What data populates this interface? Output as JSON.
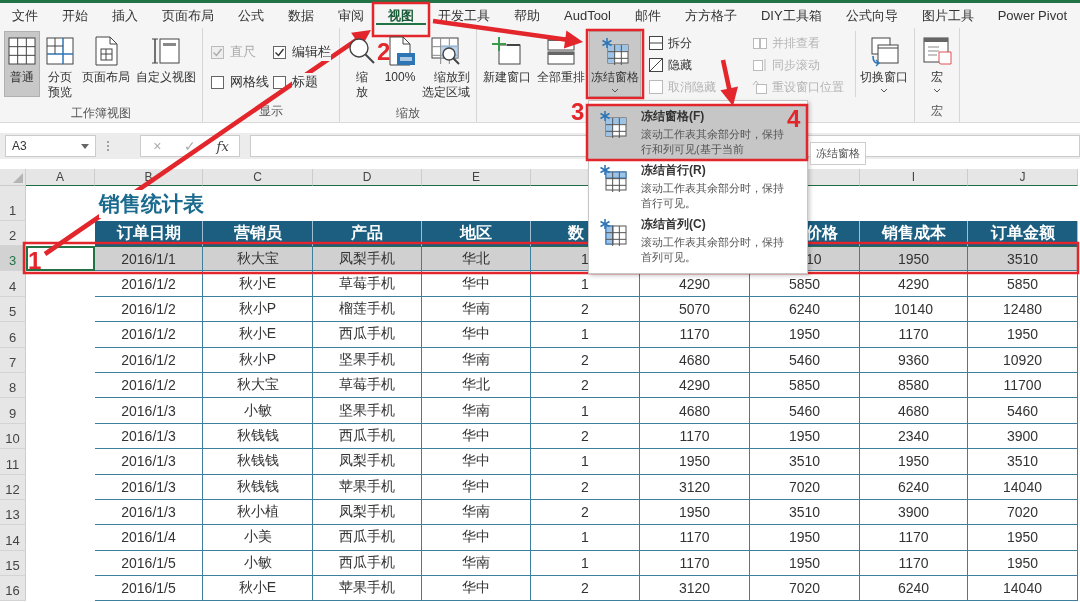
{
  "tabs": [
    {
      "label": "文件",
      "selected": false
    },
    {
      "label": "开始",
      "selected": false
    },
    {
      "label": "插入",
      "selected": false
    },
    {
      "label": "页面布局",
      "selected": false
    },
    {
      "label": "公式",
      "selected": false
    },
    {
      "label": "数据",
      "selected": false
    },
    {
      "label": "审阅",
      "selected": false
    },
    {
      "label": "视图",
      "selected": true
    },
    {
      "label": "开发工具",
      "selected": false
    },
    {
      "label": "帮助",
      "selected": false
    },
    {
      "label": "AudTool",
      "selected": false
    },
    {
      "label": "邮件",
      "selected": false
    },
    {
      "label": "方方格子",
      "selected": false
    },
    {
      "label": "DIY工具箱",
      "selected": false
    },
    {
      "label": "公式向导",
      "selected": false
    },
    {
      "label": "图片工具",
      "selected": false
    },
    {
      "label": "Power Pivot",
      "selected": false
    }
  ],
  "ribbon": {
    "groups": [
      {
        "label": "工作簿视图",
        "items": [
          {
            "kind": "large",
            "label": "普通",
            "selected": true,
            "has_menu": false
          },
          {
            "kind": "large_stacked",
            "label": "分页预览",
            "selected": false,
            "has_menu": false
          },
          {
            "kind": "large",
            "label": "页面布局",
            "selected": false,
            "has_menu": false
          },
          {
            "kind": "large",
            "label": "自定义视图",
            "selected": false,
            "has_menu": false
          }
        ]
      },
      {
        "label": "显示",
        "items": [
          {
            "kind": "check_grid",
            "items": [
              {
                "label": "直尺",
                "checked": true,
                "disabled": true
              },
              {
                "label": "编辑栏",
                "checked": true,
                "disabled": false
              },
              {
                "label": "网格线",
                "checked": false,
                "disabled": false
              },
              {
                "label": "标题",
                "checked": false,
                "disabled": false
              }
            ]
          }
        ]
      },
      {
        "label": "缩放",
        "items": [
          {
            "kind": "large_stacked",
            "label": "缩放",
            "selected": false,
            "has_menu": false
          },
          {
            "kind": "large",
            "label": "100%",
            "selected": false,
            "has_menu": false
          },
          {
            "kind": "large_stacked",
            "label": "缩放到选定区域",
            "selected": false,
            "has_menu": false
          }
        ]
      },
      {
        "items": [
          {
            "kind": "large",
            "label": "新建窗口",
            "selected": false,
            "has_menu": false
          },
          {
            "kind": "large",
            "label": "全部重排",
            "selected": false,
            "has_menu": false
          },
          {
            "kind": "large",
            "label": "冻结窗格",
            "selected": true,
            "has_menu": true
          },
          {
            "kind": "stack",
            "items": [
              {
                "label": "拆分",
                "disabled": false
              },
              {
                "label": "隐藏",
                "disabled": false
              },
              {
                "label": "取消隐藏",
                "disabled": true
              }
            ]
          },
          {
            "kind": "stack",
            "items": [
              {
                "label": "并排查看",
                "disabled": true
              },
              {
                "label": "同步滚动",
                "disabled": true
              },
              {
                "label": "重设窗口位置",
                "disabled": true
              }
            ]
          },
          {
            "kind": "large",
            "label": "切换窗口",
            "selected": false,
            "has_menu": true
          }
        ]
      },
      {
        "label": "宏",
        "items": [
          {
            "kind": "large",
            "label": "宏",
            "selected": false,
            "has_menu": true
          }
        ]
      }
    ]
  },
  "formula_bar": {
    "name_box": "A3",
    "buttons": [
      "×",
      "✓",
      "fx"
    ]
  },
  "sheet": {
    "columns": [
      "A",
      "B",
      "C",
      "D",
      "E",
      null,
      null,
      null,
      "I",
      "J"
    ],
    "rows": [
      {
        "number": "1",
        "kind": "title",
        "selected": false,
        "cells": [
          "",
          "销售统计表"
        ]
      },
      {
        "number": "2",
        "kind": "header",
        "selected": false,
        "cells": [
          "",
          "订单日期",
          "营销员",
          "产品",
          "地区",
          "数",
          null,
          "价格",
          "销售成本",
          "订单金额"
        ]
      },
      {
        "number": "3",
        "kind": "data",
        "selected": true,
        "cells": [
          "",
          "2016/1/1",
          "秋大宝",
          "凤梨手机",
          "华北",
          "1",
          null,
          "10",
          "1950",
          "3510"
        ]
      },
      {
        "number": "4",
        "kind": "data",
        "selected": false,
        "cells": [
          "",
          "2016/1/2",
          "秋小E",
          "草莓手机",
          "华中",
          "1",
          "4290",
          "5850",
          "4290",
          "5850"
        ]
      },
      {
        "number": "5",
        "kind": "data",
        "selected": false,
        "cells": [
          "",
          "2016/1/2",
          "秋小P",
          "榴莲手机",
          "华南",
          "2",
          "5070",
          "6240",
          "10140",
          "12480"
        ]
      },
      {
        "number": "6",
        "kind": "data",
        "selected": false,
        "cells": [
          "",
          "2016/1/2",
          "秋小E",
          "西瓜手机",
          "华中",
          "1",
          "1170",
          "1950",
          "1170",
          "1950"
        ]
      },
      {
        "number": "7",
        "kind": "data",
        "selected": false,
        "cells": [
          "",
          "2016/1/2",
          "秋小P",
          "坚果手机",
          "华南",
          "2",
          "4680",
          "5460",
          "9360",
          "10920"
        ]
      },
      {
        "number": "8",
        "kind": "data",
        "selected": false,
        "cells": [
          "",
          "2016/1/2",
          "秋大宝",
          "草莓手机",
          "华北",
          "2",
          "4290",
          "5850",
          "8580",
          "11700"
        ]
      },
      {
        "number": "9",
        "kind": "data",
        "selected": false,
        "cells": [
          "",
          "2016/1/3",
          "小敏",
          "坚果手机",
          "华南",
          "1",
          "4680",
          "5460",
          "4680",
          "5460"
        ]
      },
      {
        "number": "10",
        "kind": "data",
        "selected": false,
        "cells": [
          "",
          "2016/1/3",
          "秋钱钱",
          "西瓜手机",
          "华中",
          "2",
          "1170",
          "1950",
          "2340",
          "3900"
        ]
      },
      {
        "number": "11",
        "kind": "data",
        "selected": false,
        "cells": [
          "",
          "2016/1/3",
          "秋钱钱",
          "凤梨手机",
          "华中",
          "1",
          "1950",
          "3510",
          "1950",
          "3510"
        ]
      },
      {
        "number": "12",
        "kind": "data",
        "selected": false,
        "cells": [
          "",
          "2016/1/3",
          "秋钱钱",
          "苹果手机",
          "华中",
          "2",
          "3120",
          "7020",
          "6240",
          "14040"
        ]
      },
      {
        "number": "13",
        "kind": "data",
        "selected": false,
        "cells": [
          "",
          "2016/1/3",
          "秋小植",
          "凤梨手机",
          "华南",
          "2",
          "1950",
          "3510",
          "3900",
          "7020"
        ]
      },
      {
        "number": "14",
        "kind": "data",
        "selected": false,
        "cells": [
          "",
          "2016/1/4",
          "小美",
          "西瓜手机",
          "华中",
          "1",
          "1170",
          "1950",
          "1170",
          "1950"
        ]
      },
      {
        "number": "15",
        "kind": "data",
        "selected": false,
        "cells": [
          "",
          "2016/1/5",
          "小敏",
          "西瓜手机",
          "华南",
          "1",
          "1170",
          "1950",
          "1170",
          "1950"
        ]
      },
      {
        "number": "16",
        "kind": "data",
        "selected": false,
        "cells": [
          "",
          "2016/1/5",
          "秋小E",
          "苹果手机",
          "华中",
          "2",
          "3120",
          "7020",
          "6240",
          "14040"
        ]
      }
    ]
  },
  "freeze_menu": {
    "items": [
      {
        "title": "冻结窗格(F)",
        "description": "滚动工作表其余部分时，保持行和列可见(基于当前",
        "selected": true
      },
      {
        "title": "冻结首行(R)",
        "description": "滚动工作表其余部分时，保持首行可见。",
        "selected": false
      },
      {
        "title": "冻结首列(C)",
        "description": "滚动工作表其余部分时，保持首列可见。",
        "selected": false
      }
    ]
  },
  "tooltip": "冻结窗格",
  "annotations": [
    {
      "label": "1"
    },
    {
      "label": "2"
    },
    {
      "label": "3"
    },
    {
      "label": "4"
    }
  ]
}
